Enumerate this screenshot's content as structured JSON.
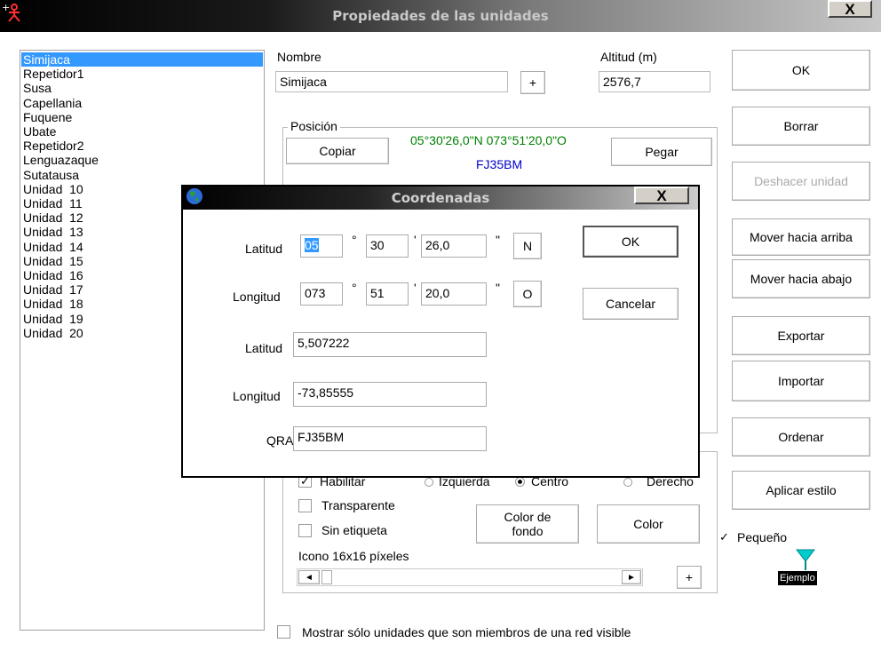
{
  "window": {
    "title": "Propiedades de las unidades",
    "close_label": "X"
  },
  "unit_list": [
    "Simijaca",
    "Repetidor1",
    "Susa",
    "Capellania",
    "Fuquene",
    "Ubate",
    "Repetidor2",
    "Lenguazaque",
    "Sutatausa",
    "Unidad  10",
    "Unidad  11",
    "Unidad  12",
    "Unidad  13",
    "Unidad  14",
    "Unidad  15",
    "Unidad  16",
    "Unidad  17",
    "Unidad  18",
    "Unidad  19",
    "Unidad  20"
  ],
  "selected_unit": "Simijaca",
  "form": {
    "nombre_label": "Nombre",
    "nombre_value": "Simijaca",
    "plus_label": "+",
    "altitud_label": "Altitud (m)",
    "altitud_value": "2576,7",
    "posicion_label": "Posición",
    "copiar_label": "Copiar",
    "pegar_label": "Pegar",
    "coords_text": "05°30'26,0\"N 073°51'20,0\"O",
    "qra_text": "FJ35BM",
    "habilitar_label": "Habilitar",
    "izquierda_label": "Izquierda",
    "centro_label": "Centro",
    "derecho_label": "Derecho",
    "transparente_label": "Transparente",
    "sin_etiqueta_label": "Sin etiqueta",
    "color_fondo_label_1": "Color de",
    "color_fondo_label_2": "fondo",
    "color_label": "Color",
    "icono_label": "Icono 16x16 píxeles",
    "scroll_left": "◄",
    "scroll_right": "►",
    "mostrar_label": "Mostrar sólo unidades que son miembros de una red visible"
  },
  "buttons": {
    "ok": "OK",
    "borrar": "Borrar",
    "deshacer": "Deshacer unidad",
    "arriba": "Mover hacia arriba",
    "abajo": "Mover hacia abajo",
    "exportar": "Exportar",
    "importar": "Importar",
    "ordenar": "Ordenar",
    "aplicar": "Aplicar estilo"
  },
  "pequeno": {
    "label": "Pequeño",
    "checked": true,
    "example_label": "Ejemplo"
  },
  "dialog": {
    "title": "Coordenadas",
    "close_label": "X",
    "latitud_label": "Latitud",
    "lat_deg": "05",
    "lat_min": "30",
    "lat_sec": "26,0",
    "lat_hemi": "N",
    "longitud_label": "Longitud",
    "lon_deg": "073",
    "lon_min": "51",
    "lon_sec": "20,0",
    "lon_hemi": "O",
    "deg_symbol": "°",
    "min_symbol": "'",
    "sec_symbol": "\"",
    "lat_decimal_label": "Latitud",
    "lat_decimal": "5,507222",
    "lon_decimal_label": "Longitud",
    "lon_decimal": "-73,85555",
    "qra_label": "QRA",
    "qra_value": "FJ35BM",
    "ok_label": "OK",
    "cancel_label": "Cancelar"
  },
  "colors": {
    "selection": "#3399ff",
    "coords_green": "#008000",
    "qra_blue": "#0000cc",
    "marker_cyan": "#00cccc"
  }
}
